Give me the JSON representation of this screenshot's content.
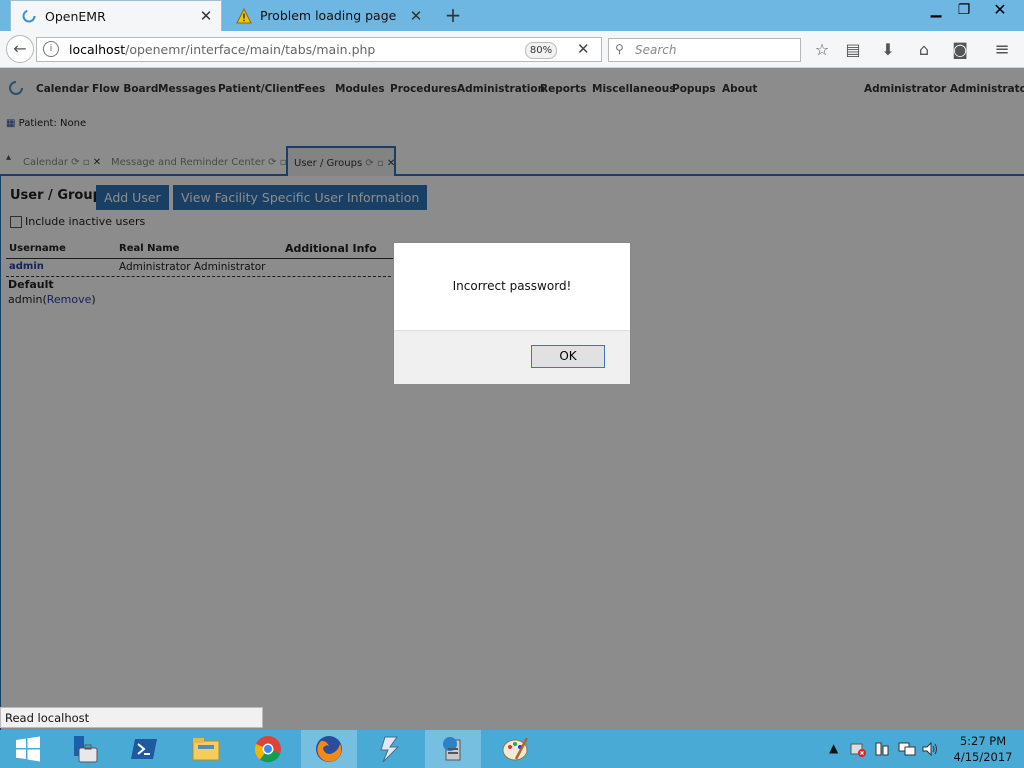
{
  "browser": {
    "tabs": [
      {
        "title": "OpenEMR",
        "active": true
      },
      {
        "title": "Problem loading page",
        "active": false
      }
    ],
    "url_host": "localhost",
    "url_path": "/openemr/interface/main/tabs/main.php",
    "zoom": "80%",
    "search_placeholder": "Search",
    "status": "Read localhost"
  },
  "emr": {
    "menu": [
      "Calendar",
      "Flow Board",
      "Messages",
      "Patient/Client",
      "Fees",
      "Modules",
      "Procedures",
      "Administration",
      "Reports",
      "Miscellaneous",
      "Popups",
      "About"
    ],
    "user": "Administrator Administrator",
    "patient": "Patient: None",
    "tabs": [
      "Calendar",
      "Message and Reminder Center",
      "User / Groups"
    ],
    "active_tab": "User / Groups"
  },
  "page": {
    "title": "User / Groups",
    "add_user": "Add User",
    "facility_info": "View Facility Specific User Information",
    "include_inactive": "Include inactive users",
    "columns": [
      "Username",
      "Real Name",
      "Additional Info"
    ],
    "rows": [
      {
        "username": "admin",
        "real_name": "Administrator Administrator"
      }
    ],
    "group_name": "Default",
    "group_member": "admin",
    "remove": "Remove"
  },
  "dialog": {
    "message": "Incorrect password!",
    "ok": "OK"
  },
  "taskbar": {
    "time": "5:27 PM",
    "date": "4/15/2017"
  },
  "colors": {
    "accent": "#2e73b8",
    "titlebar": "#6eb7e3",
    "taskbar": "#4aaad6"
  }
}
